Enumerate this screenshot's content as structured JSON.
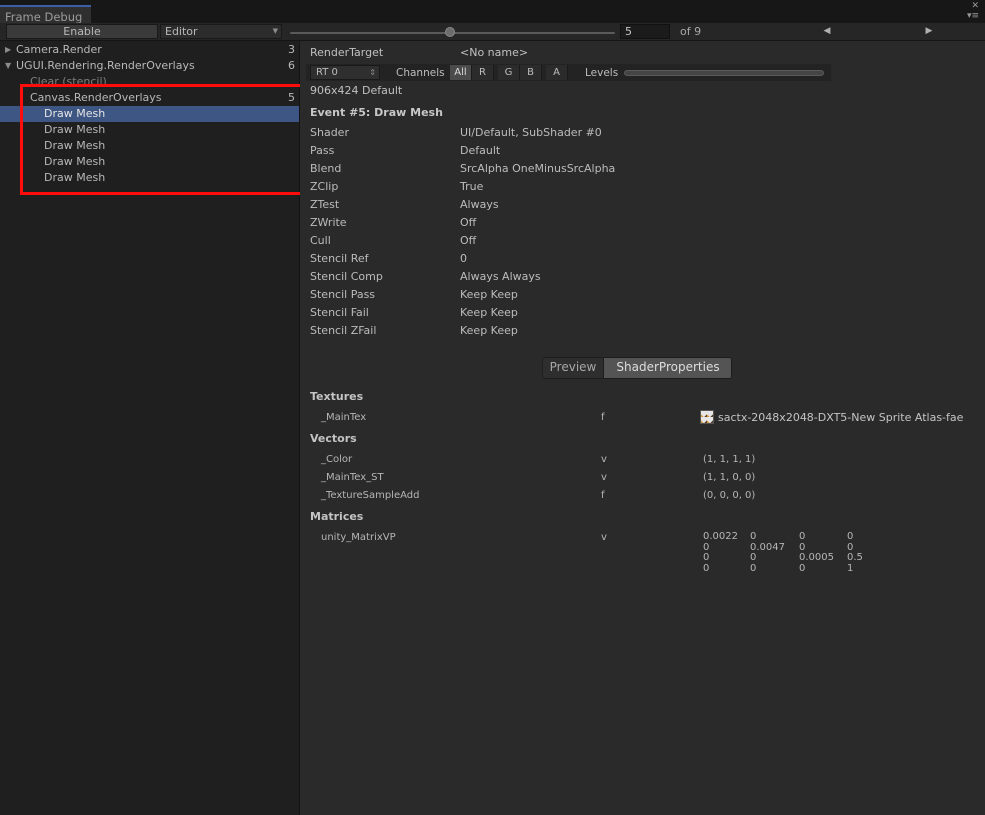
{
  "window": {
    "tab_title": "Frame Debug",
    "close_glyph": "✕",
    "menu_glyph": "▾≡"
  },
  "toolbar": {
    "enable_label": "Enable",
    "target_value": "Editor",
    "frame_value": "5",
    "frame_total": "of 9",
    "prev_glyph": "◀",
    "next_glyph": "▶"
  },
  "tree": {
    "items": [
      {
        "label": "Camera.Render",
        "count": "3"
      },
      {
        "label": "UGUI.Rendering.RenderOverlays",
        "count": "6"
      },
      {
        "label": "Clear (stencil)",
        "count": ""
      },
      {
        "label": "Canvas.RenderOverlays",
        "count": "5"
      },
      {
        "label": "Draw Mesh",
        "count": ""
      },
      {
        "label": "Draw Mesh",
        "count": ""
      },
      {
        "label": "Draw Mesh",
        "count": ""
      },
      {
        "label": "Draw Mesh",
        "count": ""
      },
      {
        "label": "Draw Mesh",
        "count": ""
      }
    ]
  },
  "render_target": {
    "label": "RenderTarget",
    "value": "<No name>",
    "rt_selected": "RT 0",
    "channels_label": "Channels",
    "channels": [
      "All",
      "R",
      "G",
      "B",
      "A"
    ],
    "active_channel": "All",
    "levels_label": "Levels",
    "resolution": "906x424 Default"
  },
  "event": {
    "title": "Event #5: Draw Mesh",
    "props": [
      {
        "name": "Shader",
        "value": "UI/Default, SubShader #0"
      },
      {
        "name": "Pass",
        "value": "Default"
      },
      {
        "name": "Blend",
        "value": "SrcAlpha OneMinusSrcAlpha"
      },
      {
        "name": "ZClip",
        "value": "True"
      },
      {
        "name": "ZTest",
        "value": "Always"
      },
      {
        "name": "ZWrite",
        "value": "Off"
      },
      {
        "name": "Cull",
        "value": "Off"
      },
      {
        "name": "Stencil Ref",
        "value": "0"
      },
      {
        "name": "Stencil Comp",
        "value": "Always Always"
      },
      {
        "name": "Stencil Pass",
        "value": "Keep Keep"
      },
      {
        "name": "Stencil Fail",
        "value": "Keep Keep"
      },
      {
        "name": "Stencil ZFail",
        "value": "Keep Keep"
      }
    ]
  },
  "tabs": {
    "preview": "Preview",
    "shader_properties": "ShaderProperties",
    "active": "ShaderProperties"
  },
  "shader_props": {
    "textures_label": "Textures",
    "textures": [
      {
        "name": "_MainTex",
        "type": "f",
        "value": "sactx-2048x2048-DXT5-New Sprite Atlas-fae"
      }
    ],
    "vectors_label": "Vectors",
    "vectors": [
      {
        "name": "_Color",
        "type": "v",
        "value": "(1, 1, 1, 1)"
      },
      {
        "name": "_MainTex_ST",
        "type": "v",
        "value": "(1, 1, 0, 0)"
      },
      {
        "name": "_TextureSampleAdd",
        "type": "f",
        "value": "(0, 0, 0, 0)"
      }
    ],
    "matrices_label": "Matrices",
    "matrices": [
      {
        "name": "unity_MatrixVP",
        "type": "v",
        "rows": [
          [
            "0.0022",
            "0",
            "0",
            "0"
          ],
          [
            "0",
            "0.0047",
            "0",
            "0"
          ],
          [
            "0",
            "0",
            "0.0005",
            "0.5"
          ],
          [
            "0",
            "0",
            "0",
            "1"
          ]
        ]
      }
    ]
  },
  "colors": {
    "selection": "#3e5683",
    "highlight_box": "#ff0c0c",
    "tab_accent": "#3c5ea8"
  }
}
